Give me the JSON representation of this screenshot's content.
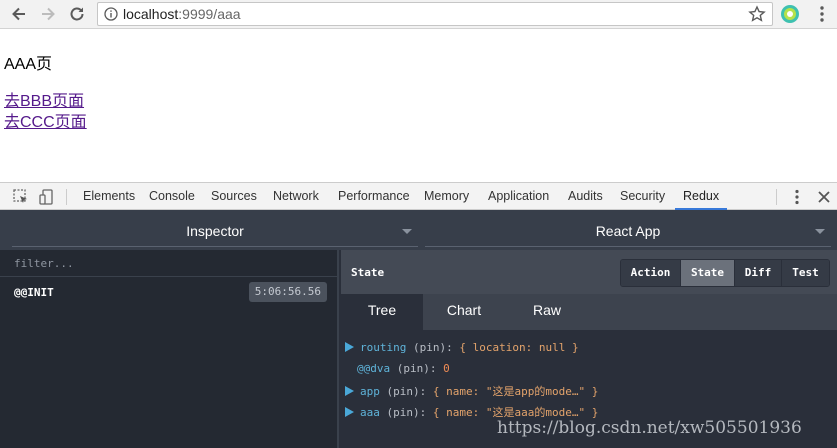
{
  "browser": {
    "url_host": "localhost",
    "url_rest": ":9999/aaa",
    "icons": {
      "back": "back-arrow-icon",
      "forward": "forward-arrow-icon",
      "reload": "reload-icon",
      "info": "info-icon",
      "bookmark": "star-icon",
      "extension": "extension-icon",
      "menu": "menu-dots-icon"
    }
  },
  "page": {
    "title": "AAA页",
    "links": [
      "去BBB页面",
      "去CCC页面"
    ],
    "link_color": "#551a8b"
  },
  "devtools": {
    "tabs": [
      "Elements",
      "Console",
      "Sources",
      "Network",
      "Performance",
      "Memory",
      "Application",
      "Audits",
      "Security",
      "Redux"
    ],
    "active_tab": "Redux",
    "accent": "#3879d9"
  },
  "redux": {
    "inspector_label": "Inspector",
    "instance_label": "React App",
    "filter_placeholder": "filter...",
    "actions": [
      {
        "name": "@@INIT",
        "time": "5:06:56.56"
      }
    ],
    "panel_title": "State",
    "view_buttons": [
      "Action",
      "State",
      "Diff",
      "Test"
    ],
    "active_view": "State",
    "sub_tabs": [
      "Tree",
      "Chart",
      "Raw"
    ],
    "active_sub_tab": "Tree",
    "tree": [
      {
        "key": "routing",
        "pin": "(pin):",
        "value": "{ location: null }",
        "expandable": true
      },
      {
        "key": "@@dva",
        "pin": "(pin):",
        "value": "0",
        "expandable": false
      },
      {
        "key": "app",
        "pin": "(pin):",
        "value": "{ name: \"这是app的mode…\" }",
        "expandable": true
      },
      {
        "key": "aaa",
        "pin": "(pin):",
        "value": "{ name: \"这是aaa的mode…\" }",
        "expandable": true
      }
    ]
  },
  "watermark": "https://blog.csdn.net/xw505501936"
}
